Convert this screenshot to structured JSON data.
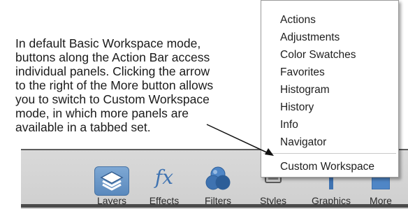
{
  "caption": {
    "lines": [
      "In default Basic Workspace mode,",
      "buttons along the Action Bar access",
      "individual panels. Clicking the arrow",
      "to the right of the More button allows",
      "you to switch to Custom Workspace",
      "mode, in which more panels are",
      "available in a tabbed set."
    ]
  },
  "menu": {
    "items": [
      "Actions",
      "Adjustments",
      "Color Swatches",
      "Favorites",
      "Histogram",
      "History",
      "Info",
      "Navigator"
    ],
    "custom_workspace": "Custom Workspace"
  },
  "action_bar": {
    "buttons": [
      {
        "label": "Layers",
        "icon": "layers-icon"
      },
      {
        "label": "Effects",
        "icon": "fx-icon"
      },
      {
        "label": "Filters",
        "icon": "filters-icon"
      },
      {
        "label": "Styles",
        "icon": "styles-icon"
      },
      {
        "label": "Graphics",
        "icon": "graphics-icon"
      },
      {
        "label": "More",
        "icon": "more-icon"
      }
    ],
    "fx_text": "fx"
  },
  "colors": {
    "accent_blue": "#3f73b1",
    "selected_button": "#6f9ccd",
    "bar_background": "#d4d4d4"
  }
}
